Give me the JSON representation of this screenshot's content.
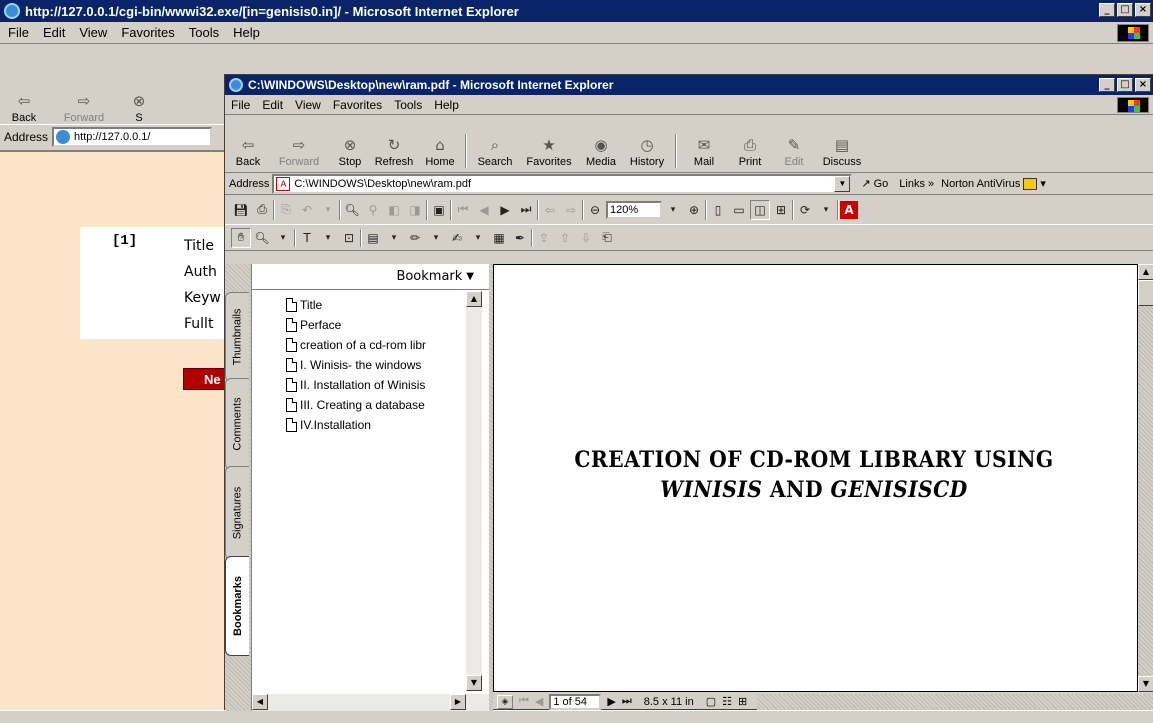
{
  "outer_window": {
    "title": "http://127.0.0.1/cgi-bin/wwwi32.exe/[in=genisis0.in]/ - Microsoft Internet Explorer",
    "menu": [
      "File",
      "Edit",
      "View",
      "Favorites",
      "Tools",
      "Help"
    ],
    "toolbar": {
      "back": "Back",
      "forward": "Forward",
      "stop_partial": "S"
    },
    "address_label": "Address",
    "address_value": "http://127.0.0.1/",
    "record": {
      "number": "[1]",
      "fields": [
        "Title",
        "Auth",
        "Keyw",
        "Fullt"
      ],
      "button": "Ne"
    }
  },
  "inner_window": {
    "title": "C:\\WINDOWS\\Desktop\\new\\ram.pdf - Microsoft Internet Explorer",
    "menu": [
      "File",
      "Edit",
      "View",
      "Favorites",
      "Tools",
      "Help"
    ],
    "toolbar": [
      "Back",
      "Forward",
      "Stop",
      "Refresh",
      "Home",
      "Search",
      "Favorites",
      "Media",
      "History",
      "Mail",
      "Print",
      "Edit",
      "Discuss"
    ],
    "address_label": "Address",
    "address_value": "C:\\WINDOWS\\Desktop\\new\\ram.pdf",
    "go_label": "Go",
    "links_label": "Links »",
    "norton_label": "Norton AntiVirus"
  },
  "pdf": {
    "zoom": "120%",
    "bookmark_header": "Bookmark",
    "tabs": [
      "Bookmarks",
      "Signatures",
      "Comments",
      "Thumbnails"
    ],
    "bookmarks": [
      "Title",
      "Perface",
      "creation of a cd-rom libr",
      "I. Winisis- the windows",
      "II. Installation of Winisis",
      "III. Creating a database",
      "IV.Installation"
    ],
    "page_title_line1": "CREATION OF CD-ROM LIBRARY USING",
    "page_title_line2_a": "WINISIS",
    "page_title_line2_b": " AND ",
    "page_title_line2_c": "GENISISCD",
    "page_indicator": "1 of 54",
    "page_size": "8.5 x 11 in"
  },
  "colors": {
    "titlebar": "#0a246a",
    "outer_page_bg": "#fce4c8",
    "record_bg": "#ffffff",
    "chrome": "#d4d0c8",
    "button_red": "#b00000"
  }
}
